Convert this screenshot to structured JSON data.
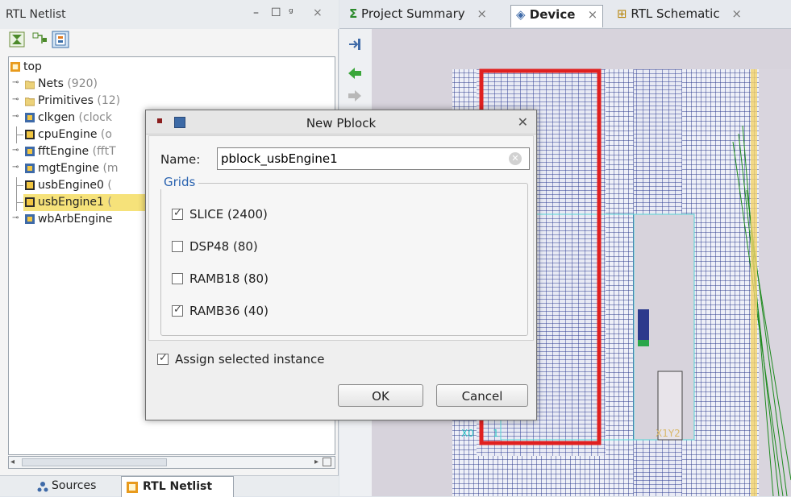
{
  "left_panel": {
    "title": "RTL Netlist",
    "window_controls": [
      "–",
      "☐",
      "ᵍ",
      "×"
    ],
    "tree": [
      {
        "label": "top",
        "count": "",
        "icon": "top-icon",
        "indent": 0,
        "highlight": false
      },
      {
        "label": "Nets",
        "count": "(920)",
        "icon": "folder-icon",
        "indent": 1,
        "highlight": false
      },
      {
        "label": "Primitives",
        "count": "(12)",
        "icon": "folder-icon",
        "indent": 1,
        "highlight": false
      },
      {
        "label": "clkgen",
        "count": "(clock",
        "icon": "module-icon",
        "indent": 1,
        "highlight": false
      },
      {
        "label": "cpuEngine",
        "count": "(o",
        "icon": "block-icon",
        "indent": 1,
        "highlight": false
      },
      {
        "label": "fftEngine",
        "count": "(fftT",
        "icon": "module-icon",
        "indent": 1,
        "highlight": false
      },
      {
        "label": "mgtEngine",
        "count": "(m",
        "icon": "module-icon",
        "indent": 1,
        "highlight": false
      },
      {
        "label": "usbEngine0",
        "count": "(",
        "icon": "block-icon",
        "indent": 1,
        "highlight": false
      },
      {
        "label": "usbEngine1",
        "count": "(",
        "icon": "block-icon",
        "indent": 1,
        "highlight": true
      },
      {
        "label": "wbArbEngine",
        "count": "",
        "icon": "module-icon",
        "indent": 1,
        "highlight": false
      }
    ],
    "bottom_tabs": [
      {
        "label": "Sources",
        "icon": "sources-icon"
      },
      {
        "label": "RTL Netlist",
        "icon": "netlist-icon"
      }
    ]
  },
  "tabs": [
    {
      "label": "Project Summary",
      "icon": "sigma-icon",
      "active": false
    },
    {
      "label": "Device",
      "icon": "device-icon",
      "active": true
    },
    {
      "label": "RTL Schematic",
      "icon": "schematic-icon",
      "active": false
    }
  ],
  "dialog": {
    "title": "New Pblock",
    "name_label": "Name:",
    "name_value": "pblock_usbEngine1",
    "grids_label": "Grids",
    "grids": [
      {
        "label": "SLICE (2400)",
        "checked": true
      },
      {
        "label": "DSP48 (80)",
        "checked": false
      },
      {
        "label": "RAMB18 (80)",
        "checked": false
      },
      {
        "label": "RAMB36 (40)",
        "checked": true
      }
    ],
    "assign_label": "Assign selected instance",
    "assign_checked": true,
    "ok_label": "OK",
    "cancel_label": "Cancel"
  },
  "device_labels": {
    "tl_label": "X0",
    "tl_label2": "1",
    "center_label": "X1Y2"
  },
  "colors": {
    "accent_blue": "#2a63b0",
    "selection_yellow": "#f6e27a",
    "pblock_red": "#e02020",
    "grid_blue": "#2c3a8c"
  }
}
